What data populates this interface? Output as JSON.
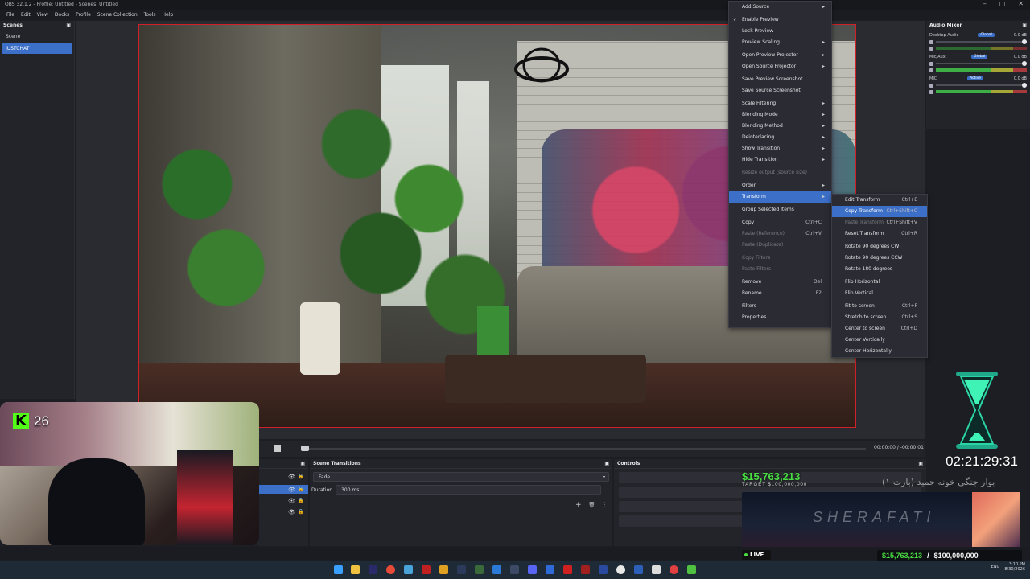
{
  "window": {
    "title": "OBS 32.1.2 - Profile: Untitled - Scenes: Untitled"
  },
  "menubar": [
    "File",
    "Edit",
    "View",
    "Docks",
    "Profile",
    "Scene Collection",
    "Tools",
    "Help"
  ],
  "scenes": {
    "title": "Scenes",
    "items": [
      {
        "label": "Scene",
        "active": false
      },
      {
        "label": "JUSTCHAT",
        "active": true
      }
    ]
  },
  "context_menu": {
    "items": [
      {
        "label": "Add Source",
        "submenu": true
      },
      {
        "label": "Enable Preview",
        "checked": true
      },
      {
        "label": "Lock Preview"
      },
      {
        "label": "Preview Scaling",
        "submenu": true
      },
      {
        "label": "Open Preview Projector",
        "submenu": true
      },
      {
        "label": "Open Source Projector",
        "submenu": true
      },
      {
        "label": "Save Preview Screenshot"
      },
      {
        "label": "Save Source Screenshot"
      },
      {
        "label": "Scale Filtering",
        "submenu": true
      },
      {
        "label": "Blending Mode",
        "submenu": true
      },
      {
        "label": "Blending Method",
        "submenu": true
      },
      {
        "label": "Deinterlacing",
        "submenu": true
      },
      {
        "label": "Show Transition",
        "submenu": true
      },
      {
        "label": "Hide Transition",
        "submenu": true
      },
      {
        "label": "Resize output (source size)",
        "disabled": true
      },
      {
        "label": "Order",
        "submenu": true
      },
      {
        "label": "Transform",
        "submenu": true,
        "highlighted": true
      },
      {
        "label": "Group Selected Items"
      },
      {
        "label": "Copy",
        "shortcut": "Ctrl+C"
      },
      {
        "label": "Paste (Reference)",
        "shortcut": "Ctrl+V",
        "disabled": true
      },
      {
        "label": "Paste (Duplicate)",
        "disabled": true
      },
      {
        "label": "Copy Filters",
        "disabled": true
      },
      {
        "label": "Paste Filters",
        "disabled": true
      },
      {
        "label": "Remove",
        "shortcut": "Del"
      },
      {
        "label": "Rename...",
        "shortcut": "F2"
      },
      {
        "label": "Filters"
      },
      {
        "label": "Properties"
      }
    ]
  },
  "transform_submenu": {
    "items": [
      {
        "label": "Edit Transform",
        "shortcut": "Ctrl+E"
      },
      {
        "label": "Copy Transform",
        "shortcut": "Ctrl+Shift+C",
        "highlighted": true
      },
      {
        "label": "Paste Transform",
        "shortcut": "Ctrl+Shift+V",
        "disabled": true
      },
      {
        "label": "Reset Transform",
        "shortcut": "Ctrl+R"
      },
      {
        "label": "Rotate 90 degrees CW"
      },
      {
        "label": "Rotate 90 degrees CCW"
      },
      {
        "label": "Rotate 180 degrees"
      },
      {
        "label": "Flip Horizontal"
      },
      {
        "label": "Flip Vertical"
      },
      {
        "label": "Fit to screen",
        "shortcut": "Ctrl+F"
      },
      {
        "label": "Stretch to screen",
        "shortcut": "Ctrl+S"
      },
      {
        "label": "Center to screen",
        "shortcut": "Ctrl+D"
      },
      {
        "label": "Center Vertically"
      },
      {
        "label": "Center Horizontally"
      }
    ]
  },
  "audio_mixer": {
    "title": "Audio Mixer",
    "channels": [
      {
        "name": "Desktop Audio",
        "badge": "Global",
        "db": "0.0 dB"
      },
      {
        "name": "Mic/Aux",
        "badge": "Global",
        "db": "0.0 dB"
      },
      {
        "name": "MIC",
        "badge": "Active",
        "db": "0.0 dB"
      }
    ]
  },
  "transport": {
    "time": "00:00:00 / -00:00:01"
  },
  "scene_transitions": {
    "title": "Scene Transitions",
    "transition": "Fade",
    "duration_label": "Duration",
    "duration_value": "300 ms"
  },
  "controls": {
    "title": "Controls"
  },
  "overlay": {
    "kick_count": "26",
    "timer": "02:21:29:31",
    "donation_amount": "$15,763,213",
    "donation_target": "TARGET $100,000,000",
    "persian_text": "(بارت ۱) بوار جنگی خونه حمید",
    "banner_name": "SHERAFATI",
    "live_label": "LIVE",
    "goal_current": "$15,763,213",
    "goal_target": "$100,000,000"
  },
  "taskbar": {
    "lang": "ENG",
    "time": "3:10 PM",
    "date": "8/30/2026"
  }
}
